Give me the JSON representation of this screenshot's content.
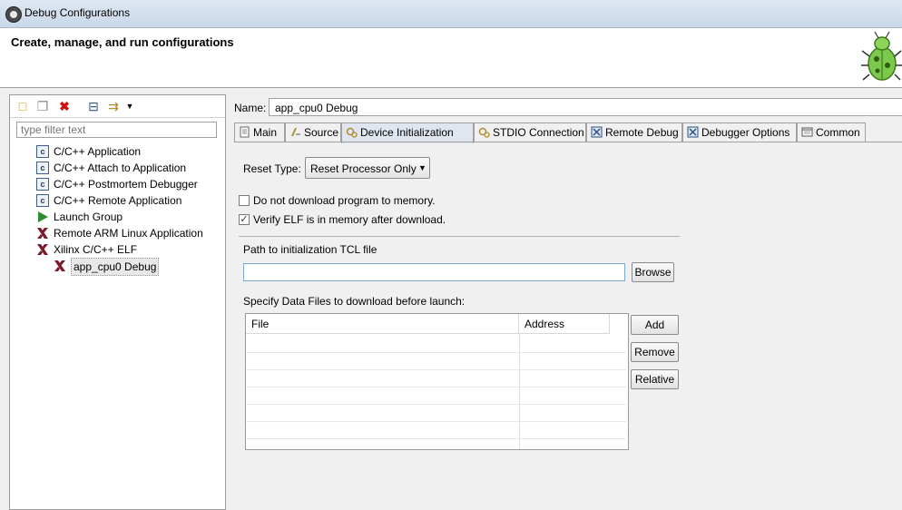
{
  "window": {
    "title": "Debug Configurations"
  },
  "header": {
    "heading": "Create, manage, and run configurations"
  },
  "left": {
    "filter_placeholder": "type filter text",
    "tree": [
      {
        "label": "C/C++ Application",
        "icon": "c-config-icon"
      },
      {
        "label": "C/C++ Attach to Application",
        "icon": "c-config-icon"
      },
      {
        "label": "C/C++ Postmortem Debugger",
        "icon": "c-config-icon"
      },
      {
        "label": "C/C++ Remote Application",
        "icon": "c-config-icon"
      },
      {
        "label": "Launch Group",
        "icon": "launch-group-icon"
      },
      {
        "label": "Remote ARM Linux Application",
        "icon": "xilinx-icon"
      },
      {
        "label": "Xilinx C/C++ ELF",
        "icon": "xilinx-icon"
      },
      {
        "label": "app_cpu0 Debug",
        "icon": "xilinx-icon",
        "selected": true
      }
    ]
  },
  "right": {
    "name_label": "Name:",
    "name_value": "app_cpu0 Debug",
    "tabs": [
      {
        "label": "Main"
      },
      {
        "label": "Source"
      },
      {
        "label": "Device Initialization",
        "active": true
      },
      {
        "label": "STDIO Connection"
      },
      {
        "label": "Remote Debug"
      },
      {
        "label": "Debugger Options"
      },
      {
        "label": "Common"
      }
    ],
    "reset_type_label": "Reset Type:",
    "reset_type_value": "Reset Processor Only",
    "no_download_label": "Do not download program to memory.",
    "no_download_checked": false,
    "verify_elf_label": "Verify ELF is in memory after download.",
    "verify_elf_checked": true,
    "tcl_label": "Path to initialization TCL file",
    "tcl_value": "",
    "browse_label": "Browse",
    "data_files_label": "Specify Data Files to download before launch:",
    "table_headers": [
      "File",
      "Address"
    ],
    "add_label": "Add",
    "remove_label": "Remove",
    "relative_label": "Relative"
  },
  "colors": {
    "active_tab": "#dfe6f0",
    "xilinx": "#7a1a2a",
    "launch": "#2e8b2e"
  }
}
